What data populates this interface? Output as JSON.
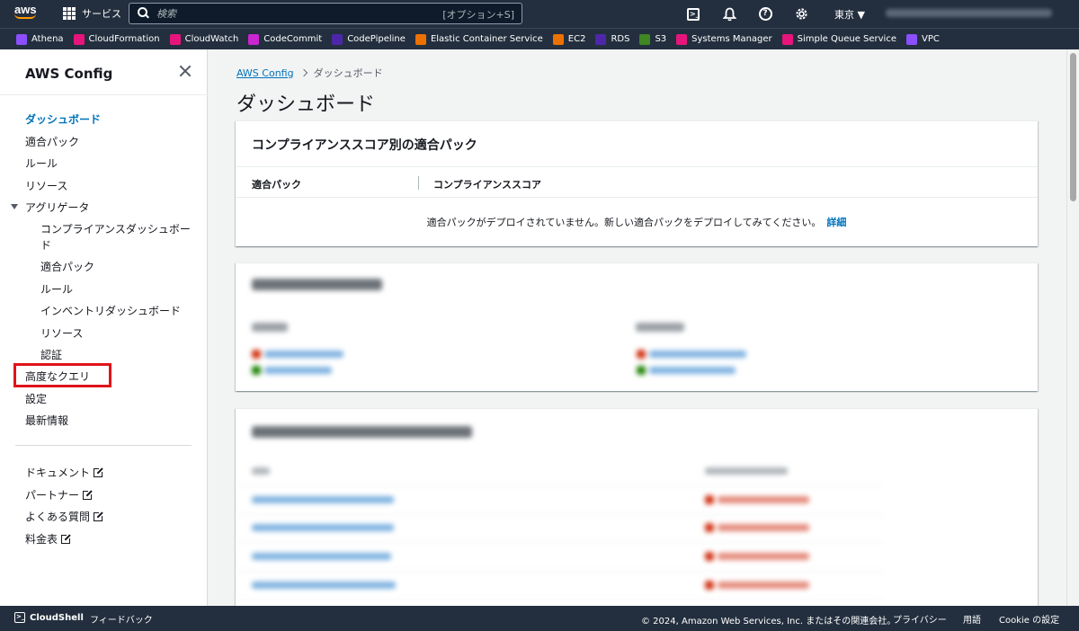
{
  "topnav": {
    "logo_text": "aws",
    "services_label": "サービス",
    "search_placeholder": "検索",
    "search_hint": "[オプション+S]",
    "region": "東京 ▼",
    "icons": [
      "cloudshell-icon",
      "bell-icon",
      "help-icon",
      "gear-icon"
    ]
  },
  "favorites": [
    {
      "label": "Athena",
      "color": "#8c4fff"
    },
    {
      "label": "CloudFormation",
      "color": "#e7157b"
    },
    {
      "label": "CloudWatch",
      "color": "#e7157b"
    },
    {
      "label": "CodeCommit",
      "color": "#c925d1"
    },
    {
      "label": "CodePipeline",
      "color": "#4d27aa"
    },
    {
      "label": "Elastic Container Service",
      "color": "#ed7100"
    },
    {
      "label": "EC2",
      "color": "#ed7100"
    },
    {
      "label": "RDS",
      "color": "#4d27aa"
    },
    {
      "label": "S3",
      "color": "#3f8624"
    },
    {
      "label": "Systems Manager",
      "color": "#e7157b"
    },
    {
      "label": "Simple Queue Service",
      "color": "#e7157b"
    },
    {
      "label": "VPC",
      "color": "#8c4fff"
    }
  ],
  "sidenav": {
    "title": "AWS Config",
    "items": {
      "dashboard": "ダッシュボード",
      "conformance_packs": "適合パック",
      "rules": "ルール",
      "resources": "リソース",
      "aggregators": "アグリゲータ",
      "agg_compliance_dashboard_1": "コンプライアンスダッシュボー",
      "agg_compliance_dashboard_2": "ド",
      "agg_conformance_packs": "適合パック",
      "agg_rules": "ルール",
      "agg_inventory_dashboard": "インベントリダッシュボード",
      "agg_resources": "リソース",
      "agg_authorizations": "認証",
      "advanced_queries": "高度なクエリ",
      "settings": "設定",
      "whats_new": "最新情報",
      "documentation": "ドキュメント",
      "partners": "パートナー",
      "faq": "よくある質問",
      "pricing": "料金表"
    }
  },
  "breadcrumb": {
    "root": "AWS Config",
    "current": "ダッシュボード"
  },
  "page_title": "ダッシュボード",
  "conformance_panel": {
    "title": "コンプライアンススコア別の適合パック",
    "col_pack": "適合パック",
    "col_score": "コンプライアンススコア",
    "empty_message": "適合パックがデプロイされていません。新しい適合パックをデプロイしてみてください。",
    "empty_link": "詳細"
  },
  "footer": {
    "cloudshell": "CloudShell",
    "feedback": "フィードバック",
    "copyright": "© 2024, Amazon Web Services, Inc. またはその関連会社。",
    "privacy": "プライバシー",
    "terms": "用語",
    "cookie": "Cookie の設定"
  }
}
